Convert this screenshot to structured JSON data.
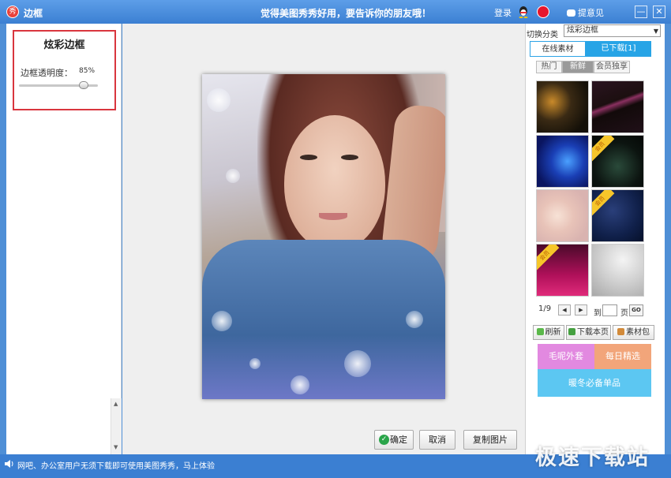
{
  "window": {
    "title": "边框",
    "slogan": "觉得美图秀秀好用，要告诉你的朋友哦！",
    "login": "登录",
    "feedback": "提意见",
    "minimize": "—",
    "close": "✕"
  },
  "left_panel": {
    "title": "炫彩边框",
    "opacity_label": "边框透明度：",
    "opacity_value_text": "85%",
    "opacity": 0.85
  },
  "canvas": {
    "ok_label": "确定",
    "cancel_label": "取消",
    "copy_label": "复制图片"
  },
  "right_panel": {
    "category_label": "切换分类",
    "category_selected": "炫彩边框",
    "tabs": {
      "online": "在线素材",
      "downloaded": "已下载[1]"
    },
    "filters": {
      "hot": "热门",
      "new": "新鲜",
      "vip": "会员独享"
    },
    "vip_badge": "会员",
    "pager": {
      "current": "1/9",
      "to": "到",
      "page": "页",
      "go": "GO",
      "input": ""
    },
    "actions": {
      "refresh": "刷新",
      "download_page": "下载本页",
      "material_pack": "素材包"
    },
    "banners": {
      "a": "毛呢外套",
      "b": "每日精选",
      "c": "暖冬必备单品"
    }
  },
  "statusbar": {
    "text": "网吧、办公室用户无须下载即可使用美图秀秀，马上体验"
  },
  "watermark": "极速下载站",
  "colors": {
    "titlebar": "#3b7fd2",
    "highlight_border": "#d9363e",
    "tab_active": "#27a4e6",
    "vip_ribbon": "#f6c62a"
  }
}
